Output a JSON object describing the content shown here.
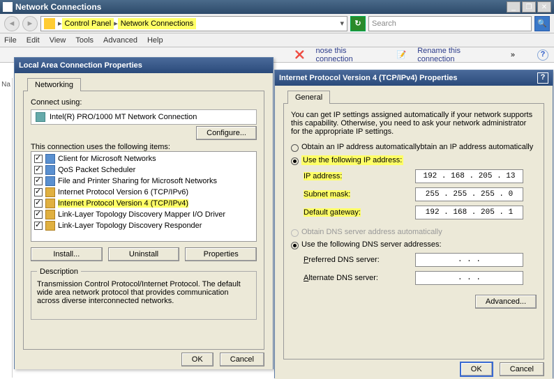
{
  "window": {
    "title": "Network Connections",
    "minimize": "_",
    "restore": "❐",
    "close": "✕"
  },
  "breadcrumb": {
    "part1": "Control Panel",
    "part2": "Network Connections",
    "dropdown": "▾"
  },
  "search": {
    "placeholder": "Search"
  },
  "menu": {
    "file": "File",
    "edit": "Edit",
    "view": "View",
    "tools": "Tools",
    "advanced": "Advanced",
    "help": "Help"
  },
  "toolbar": {
    "diagnose": "nose this connection",
    "diagnose_icon": "❌",
    "rename": "Rename this connection",
    "rename_icon": "📝",
    "more": "»",
    "help": "?"
  },
  "sidebar": {
    "nameCol": "Na"
  },
  "lac": {
    "title": "Local Area Connection Properties",
    "help": "?",
    "tab": "Networking",
    "connectUsing": "Connect using:",
    "adapter": "Intel(R) PRO/1000 MT Network Connection",
    "adapter_icon": "nic-icon",
    "configure": "Configure...",
    "itemsLabel": "This connection uses the following items:",
    "items": [
      {
        "label": "Client for Microsoft Networks"
      },
      {
        "label": "QoS Packet Scheduler"
      },
      {
        "label": "File and Printer Sharing for Microsoft Networks"
      },
      {
        "label": "Internet Protocol Version 6 (TCP/IPv6)"
      },
      {
        "label": "Internet Protocol Version 4 (TCP/IPv4)"
      },
      {
        "label": "Link-Layer Topology Discovery Mapper I/O Driver"
      },
      {
        "label": "Link-Layer Topology Discovery Responder"
      }
    ],
    "install": "Install...",
    "uninstall": "Uninstall",
    "properties": "Properties",
    "descTitle": "Description",
    "desc": "Transmission Control Protocol/Internet Protocol. The default wide area network protocol that provides communication across diverse interconnected networks.",
    "ok": "OK",
    "cancel": "Cancel"
  },
  "ipv4": {
    "title": "Internet Protocol Version 4 (TCP/IPv4) Properties",
    "help": "?",
    "tab": "General",
    "intro": "You can get IP settings assigned automatically if your network supports this capability. Otherwise, you need to ask your network administrator for the appropriate IP settings.",
    "optAuto": "Obtain an IP address automatically",
    "optManual": "Use the following IP address:",
    "ipLabel": "IP address:",
    "ip": "192 . 168 . 205 .  13",
    "maskLabel": "Subnet mask:",
    "mask": "255 . 255 . 255 .   0",
    "gwLabel": "Default gateway:",
    "gw": "192 . 168 . 205 .   1",
    "dnsAuto": "Obtain DNS server address automatically",
    "dnsManual": "Use the following DNS server addresses:",
    "dns1Label": "Preferred DNS server:",
    "dns1": "   .    .    .   ",
    "dns2Label": "Alternate DNS server:",
    "dns2": "   .    .    .   ",
    "advanced": "Advanced...",
    "ok": "OK",
    "cancel": "Cancel"
  }
}
